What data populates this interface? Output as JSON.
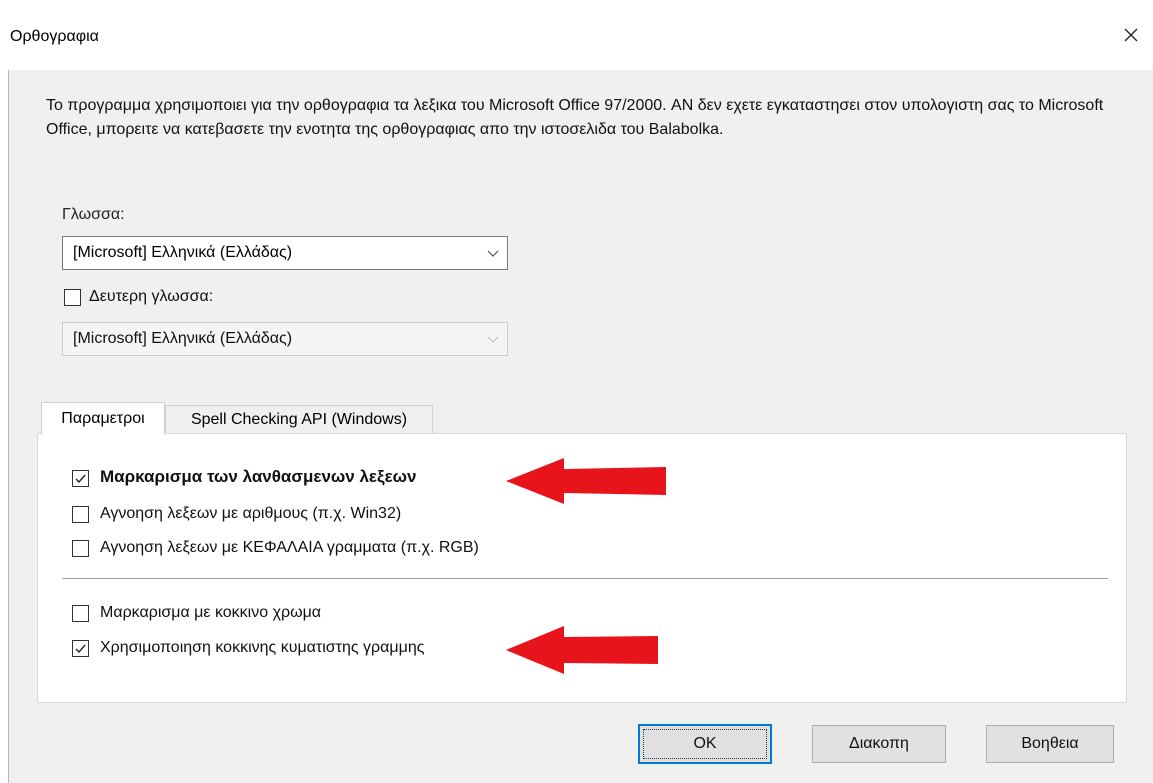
{
  "window": {
    "title": "Ορθογραφια",
    "close_icon": "close-icon"
  },
  "info_text": "Το προγραμμα χρησιμοποιει για την ορθογραφια τα λεξικα του Microsoft Office 97/2000. ΑΝ δεν εχετε εγκαταστησει στον υπολογιστη σας το Microsoft Office, μπορειτε να κατεβασετε την ενοτητα της ορθογραφιας απο την ιστοσελιδα του Balabolka.",
  "language": {
    "label": "Γλωσσα:",
    "value": "[Microsoft] Ελληνικά (Ελλάδας)"
  },
  "second_language": {
    "checkbox_label": "Δευτερη γλωσσα:",
    "checked": false,
    "value": "[Microsoft] Ελληνικά (Ελλάδας)"
  },
  "tabs": [
    {
      "label": "Παραμετροι",
      "active": true
    },
    {
      "label": "Spell Checking API (Windows)",
      "active": false
    }
  ],
  "options": [
    {
      "label": "Μαρκαρισμα των λανθασμενων λεξεων",
      "checked": true
    },
    {
      "label": "Αγνοηση λεξεων με αριθμους (π.χ. Win32)",
      "checked": false
    },
    {
      "label": "Αγνοηση λεξεων με ΚΕΦΑΛΑΙΑ γραμματα (π.χ. RGB)",
      "checked": false
    },
    {
      "label": "Μαρκαρισμα με κοκκινο χρωμα",
      "checked": false
    },
    {
      "label": "Χρησιμοποιηση κοκκινης κυματιστης γραμμης",
      "checked": true
    }
  ],
  "buttons": {
    "ok": "OK",
    "cancel": "Διακοπη",
    "help": "Βοηθεια"
  },
  "colors": {
    "dialog_bg": "#f0f0f0",
    "accent": "#0078d7",
    "annotation_arrow": "#e8141b"
  }
}
